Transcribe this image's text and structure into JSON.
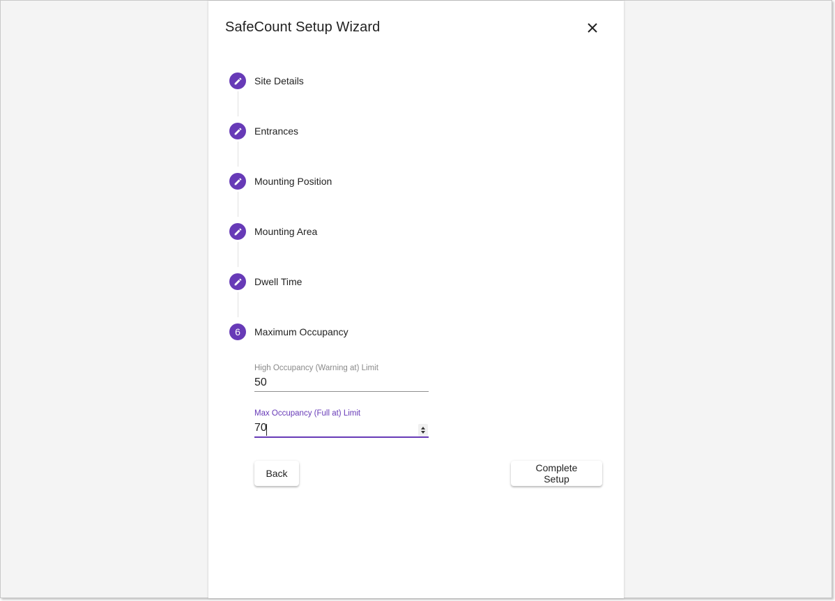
{
  "dialog": {
    "title": "SafeCount Setup Wizard",
    "close_icon": "close-icon",
    "accent_color": "#673ab7"
  },
  "steps": [
    {
      "label": "Site Details",
      "icon": "edit-icon"
    },
    {
      "label": "Entrances",
      "icon": "edit-icon"
    },
    {
      "label": "Mounting Position",
      "icon": "edit-icon"
    },
    {
      "label": "Mounting Area",
      "icon": "edit-icon"
    },
    {
      "label": "Dwell Time",
      "icon": "edit-icon"
    },
    {
      "label": "Maximum Occupancy",
      "number": "6",
      "active": true
    }
  ],
  "form": {
    "high_occupancy": {
      "label": "High Occupancy (Warning at) Limit",
      "value": "50"
    },
    "max_occupancy": {
      "label": "Max Occupancy (Full at) Limit",
      "value": "70"
    }
  },
  "buttons": {
    "back": "Back",
    "complete": "Complete Setup"
  }
}
